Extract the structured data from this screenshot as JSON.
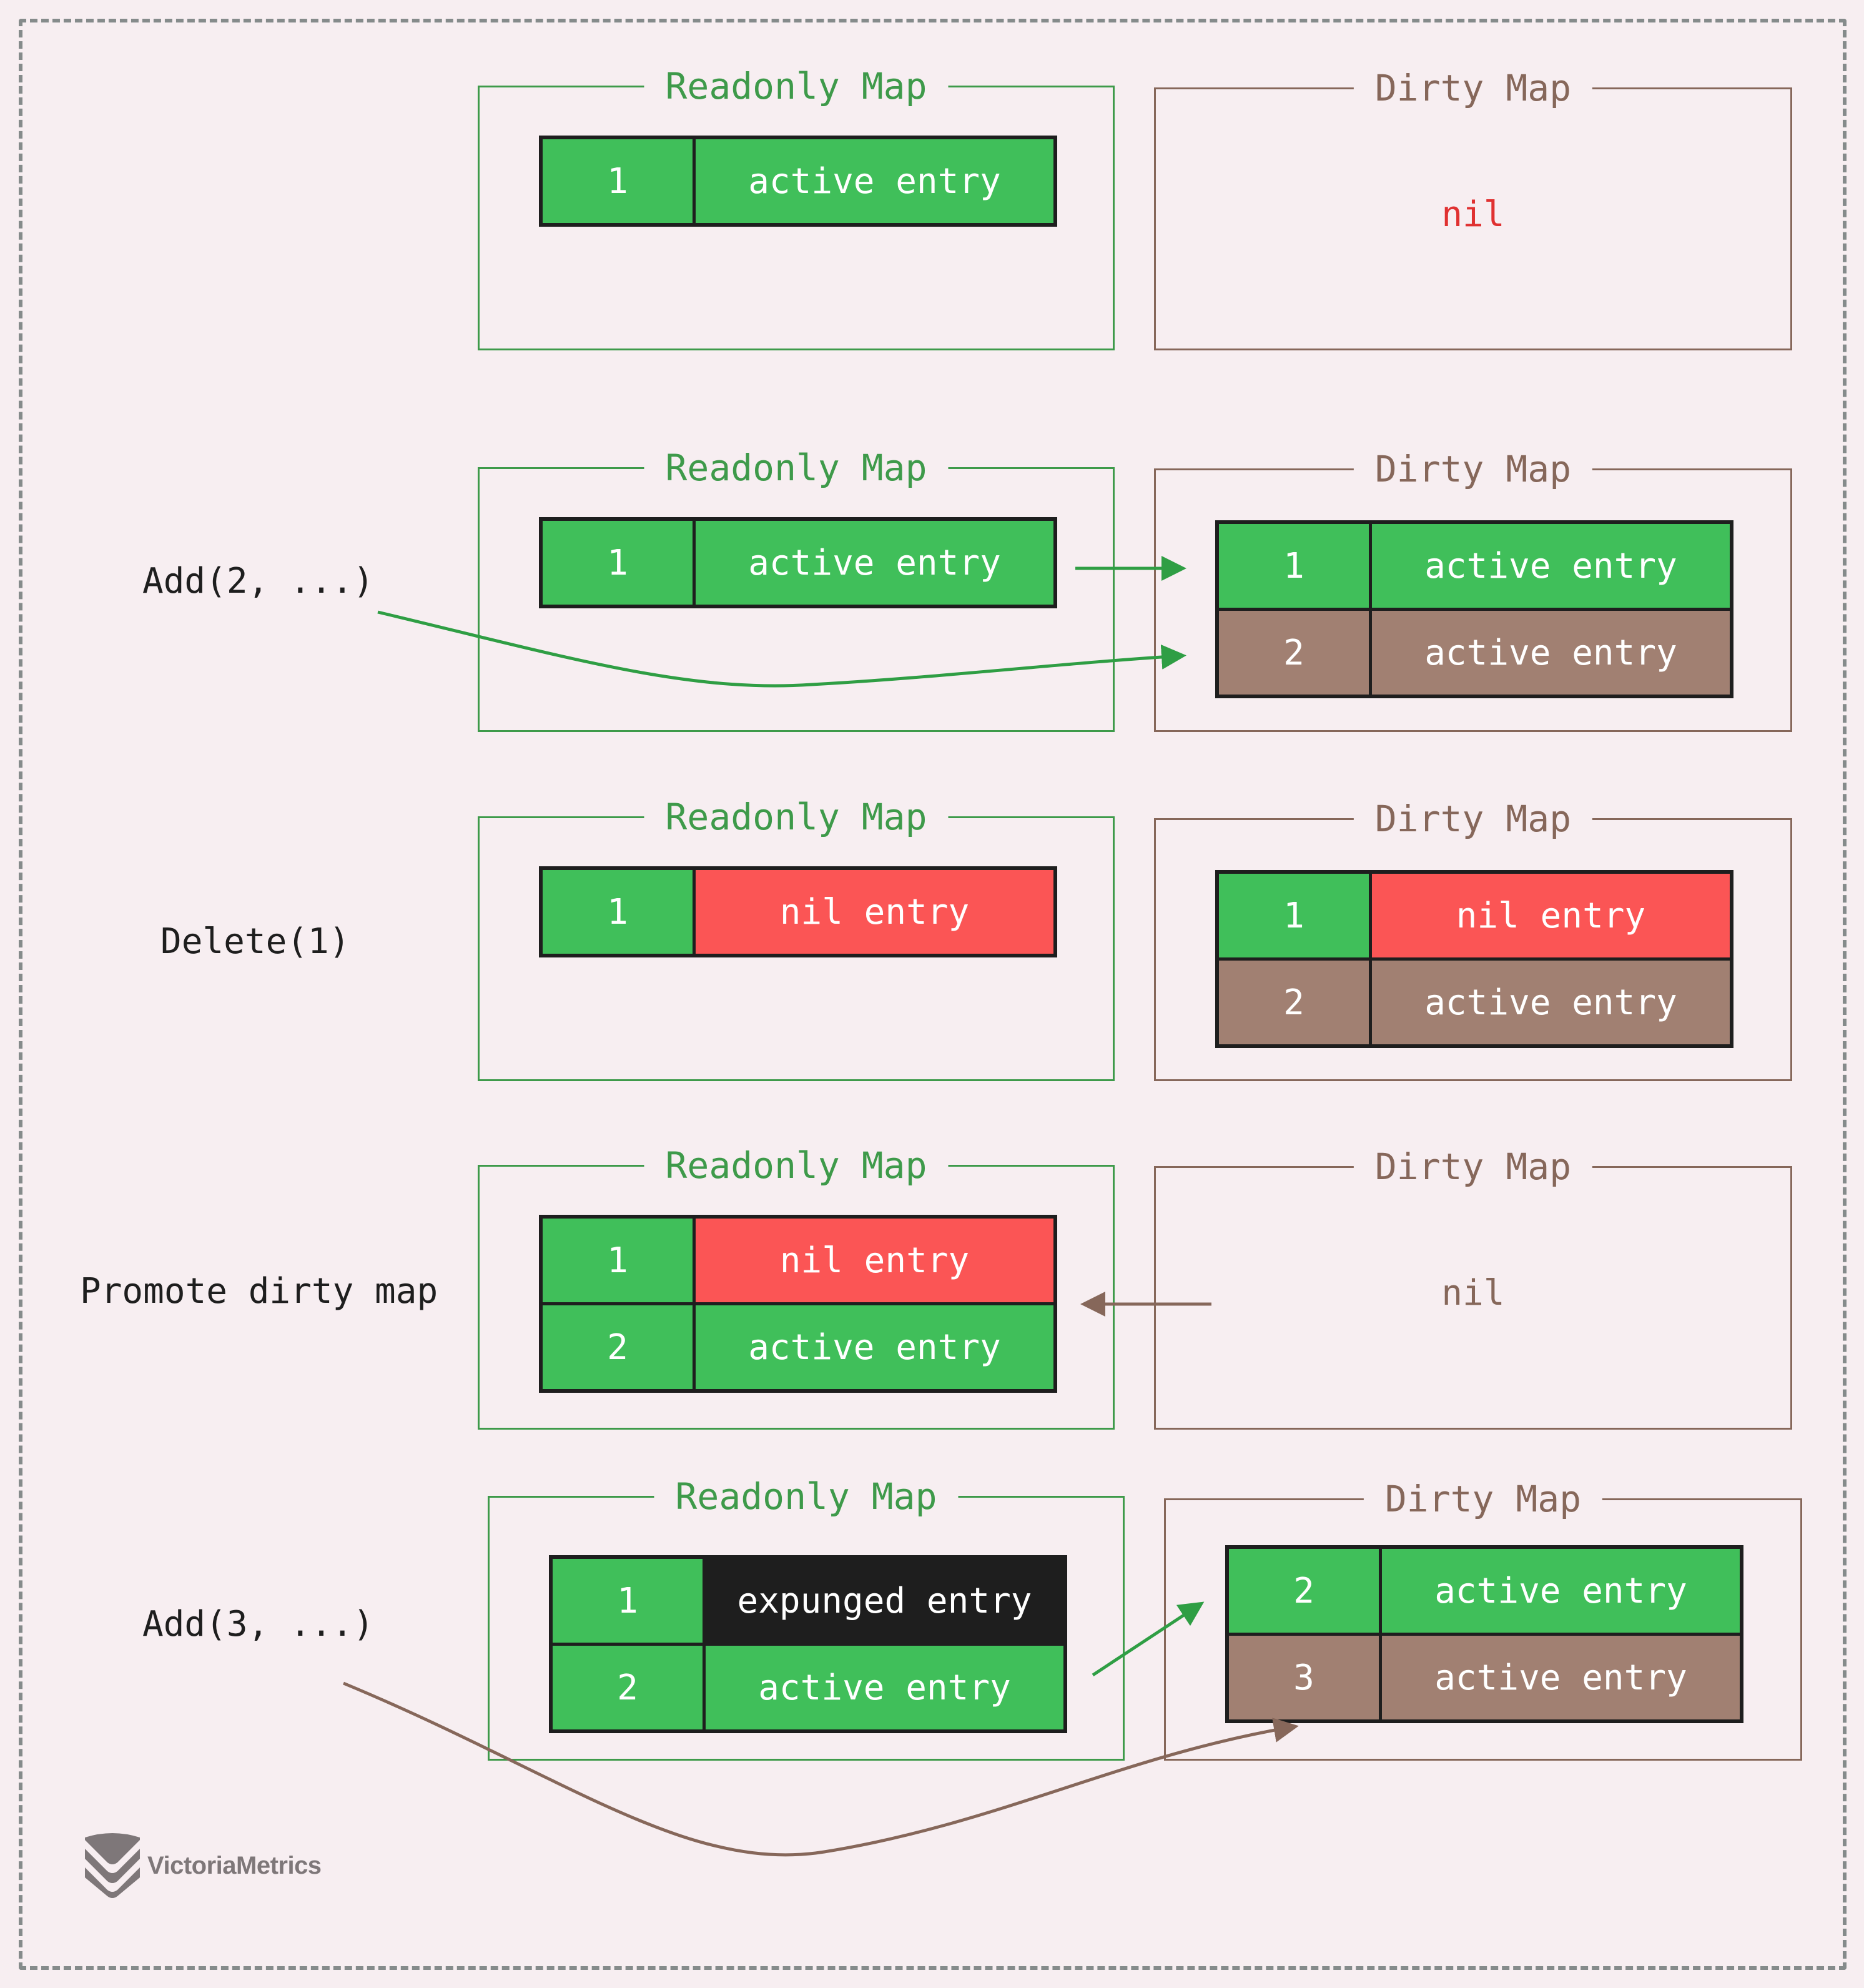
{
  "colors": {
    "background": "#f7eef1",
    "frame": "#858b8b",
    "readonly_accent": "#3e9a4a",
    "dirty_accent": "#86675a",
    "active_green": "#40bf5a",
    "new_brown": "#a18072",
    "nil_red": "#fb5555",
    "expunged_black": "#1e1e1e",
    "nil_text_red": "#e03131",
    "label_text": "#1e1e1e",
    "logo_gray": "#7e7779"
  },
  "steps": [
    {
      "operation": "",
      "readonly": {
        "title": "Readonly Map",
        "rows": [
          {
            "key": "1",
            "value": "active entry",
            "key_color": "active_green",
            "value_color": "active_green"
          }
        ]
      },
      "dirty": {
        "title": "Dirty Map",
        "nil_label": "nil",
        "nil_color": "nil_text_red",
        "rows": []
      }
    },
    {
      "operation": "Add(2, ...)",
      "readonly": {
        "title": "Readonly Map",
        "rows": [
          {
            "key": "1",
            "value": "active entry",
            "key_color": "active_green",
            "value_color": "active_green"
          }
        ]
      },
      "dirty": {
        "title": "Dirty Map",
        "rows": [
          {
            "key": "1",
            "value": "active entry",
            "key_color": "active_green",
            "value_color": "active_green"
          },
          {
            "key": "2",
            "value": "active entry",
            "key_color": "new_brown",
            "value_color": "new_brown"
          }
        ]
      }
    },
    {
      "operation": "Delete(1)",
      "readonly": {
        "title": "Readonly Map",
        "rows": [
          {
            "key": "1",
            "value": "nil entry",
            "key_color": "active_green",
            "value_color": "nil_red"
          }
        ]
      },
      "dirty": {
        "title": "Dirty Map",
        "rows": [
          {
            "key": "1",
            "value": "nil entry",
            "key_color": "active_green",
            "value_color": "nil_red"
          },
          {
            "key": "2",
            "value": "active entry",
            "key_color": "new_brown",
            "value_color": "new_brown"
          }
        ]
      }
    },
    {
      "operation": "Promote dirty map",
      "readonly": {
        "title": "Readonly Map",
        "rows": [
          {
            "key": "1",
            "value": "nil entry",
            "key_color": "active_green",
            "value_color": "nil_red"
          },
          {
            "key": "2",
            "value": "active entry",
            "key_color": "active_green",
            "value_color": "active_green"
          }
        ]
      },
      "dirty": {
        "title": "Dirty Map",
        "nil_label": "nil",
        "nil_color": "dirty_accent",
        "rows": []
      }
    },
    {
      "operation": "Add(3, ...)",
      "readonly": {
        "title": "Readonly Map",
        "rows": [
          {
            "key": "1",
            "value": "expunged entry",
            "key_color": "active_green",
            "value_color": "expunged_black"
          },
          {
            "key": "2",
            "value": "active entry",
            "key_color": "active_green",
            "value_color": "active_green"
          }
        ]
      },
      "dirty": {
        "title": "Dirty Map",
        "rows": [
          {
            "key": "2",
            "value": "active entry",
            "key_color": "active_green",
            "value_color": "active_green"
          },
          {
            "key": "3",
            "value": "active entry",
            "key_color": "new_brown",
            "value_color": "new_brown"
          }
        ]
      }
    }
  ],
  "logo": {
    "text": "VictoriaMetrics",
    "icon": "victoriametrics-logo-icon"
  }
}
